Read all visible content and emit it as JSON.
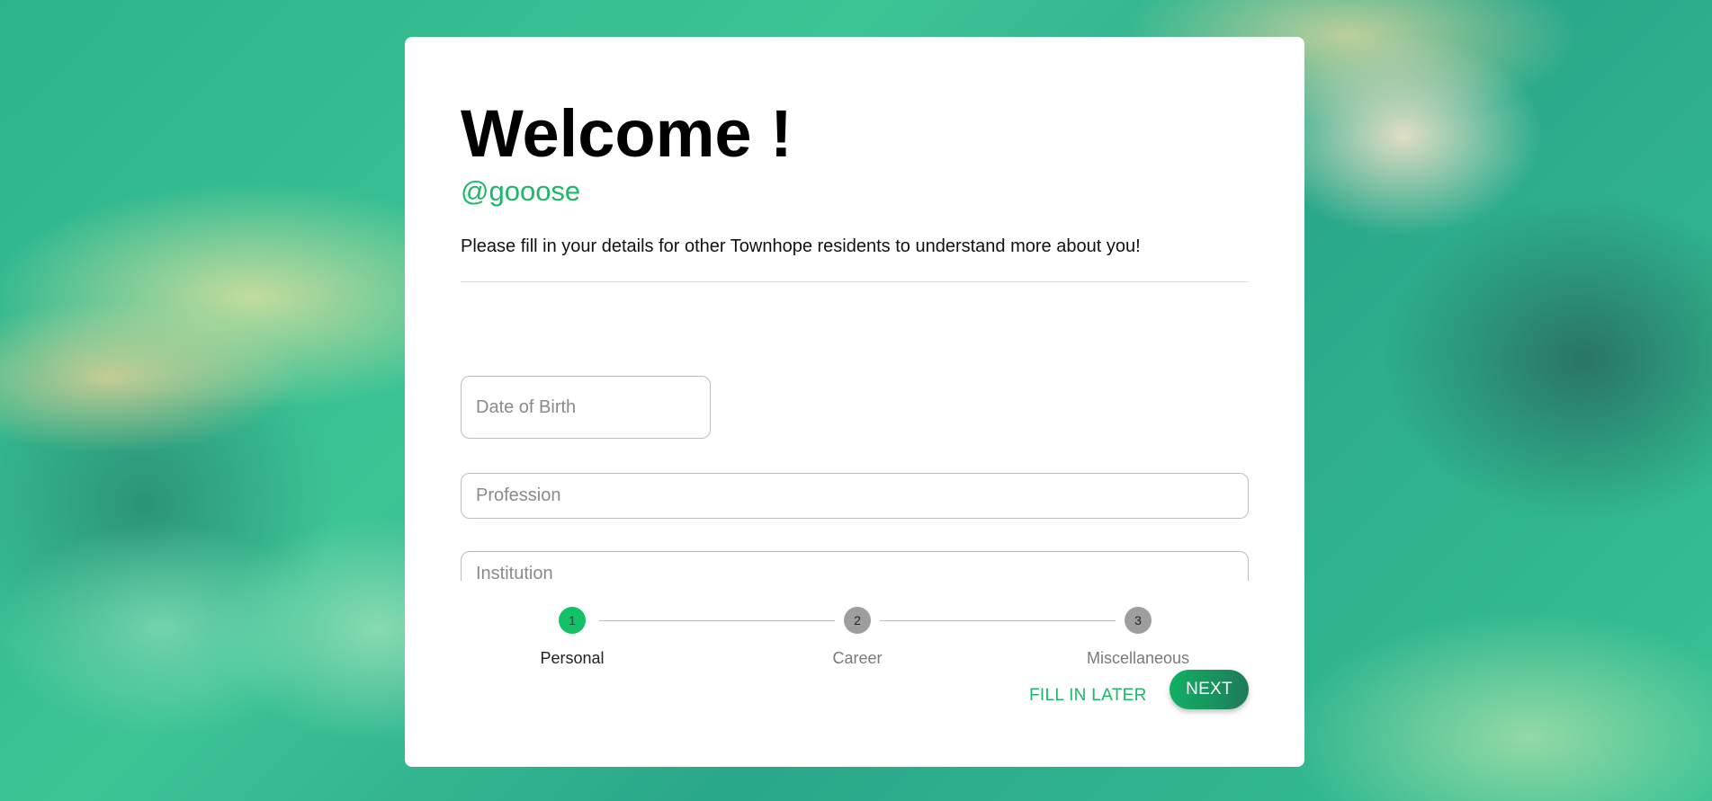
{
  "welcome": {
    "title": "Welcome !",
    "handle": "@gooose",
    "intro": "Please fill in your details for other Townhope residents to understand more about you!"
  },
  "form": {
    "date_of_birth_placeholder": "Date of Birth",
    "profession_placeholder": "Profession",
    "institution_placeholder": "Institution"
  },
  "stepper": {
    "steps": [
      {
        "number": "1",
        "label": "Personal",
        "active": true
      },
      {
        "number": "2",
        "label": "Career",
        "active": false
      },
      {
        "number": "3",
        "label": "Miscellaneous",
        "active": false
      }
    ]
  },
  "actions": {
    "fill_later_label": "FILL IN LATER",
    "next_label": "NEXT"
  },
  "colors": {
    "accent": "#1cb768",
    "active_step": "#13c167",
    "inactive_step": "#9e9e9e"
  }
}
